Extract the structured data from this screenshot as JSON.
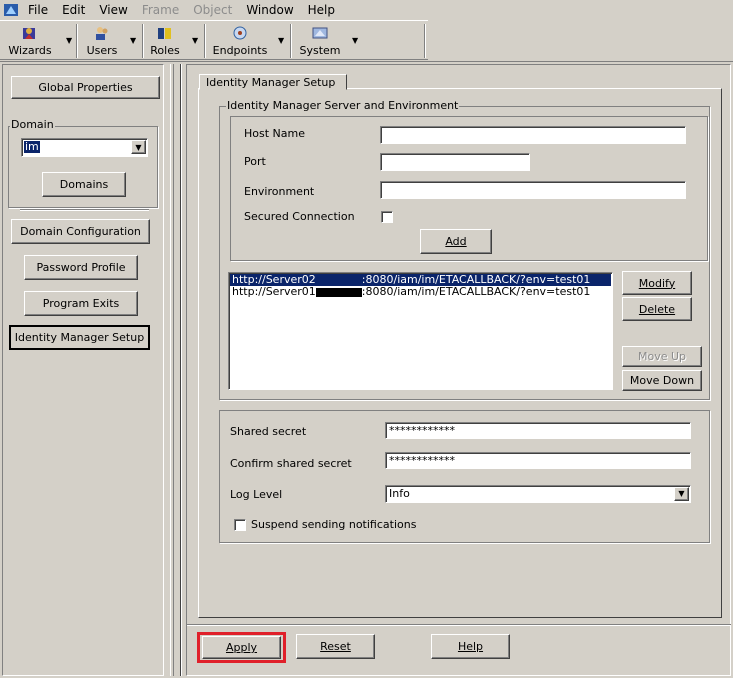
{
  "menubar": {
    "items": [
      {
        "label": "File",
        "enabled": true
      },
      {
        "label": "Edit",
        "enabled": true
      },
      {
        "label": "View",
        "enabled": true
      },
      {
        "label": "Frame",
        "enabled": false
      },
      {
        "label": "Object",
        "enabled": false
      },
      {
        "label": "Window",
        "enabled": true
      },
      {
        "label": "Help",
        "enabled": true
      }
    ]
  },
  "toolbar": {
    "wizards": "Wizards",
    "users": "Users",
    "roles": "Roles",
    "endpoints": "Endpoints",
    "system": "System"
  },
  "sidebar": {
    "global_properties": "Global Properties",
    "domain_group": "Domain",
    "domain_value": "im",
    "domains_button": "Domains",
    "domain_configuration": "Domain Configuration",
    "password_profile": "Password Profile",
    "program_exits": "Program Exits",
    "identity_manager_setup": "Identity Manager Setup"
  },
  "main": {
    "tab": "Identity Manager Setup",
    "group_title": "Identity Manager Server and Environment",
    "host_name_label": "Host Name",
    "host_name_value": "",
    "port_label": "Port",
    "port_value": "",
    "environment_label": "Environment",
    "environment_value": "",
    "secured_connection_label": "Secured Connection",
    "add_button": "Add",
    "servers": [
      {
        "prefix": "http://Server02",
        "suffix": ":8080/iam/im/ETACALLBACK/?env=test01",
        "selected": true
      },
      {
        "prefix": "http://Server01",
        "suffix": ":8080/iam/im/ETACALLBACK/?env=test01",
        "selected": false
      }
    ],
    "modify_button": "Modify",
    "delete_button": "Delete",
    "move_up_button": "Move Up",
    "move_down_button": "Move Down",
    "shared_secret_label": "Shared secret",
    "shared_secret_value": "************",
    "confirm_secret_label": "Confirm shared secret",
    "confirm_secret_value": "************",
    "log_level_label": "Log Level",
    "log_level_value": "Info",
    "suspend_label": "Suspend sending notifications"
  },
  "footer": {
    "apply": "Apply",
    "reset": "Reset",
    "help": "Help"
  },
  "colors": {
    "selection": "#0a246a",
    "highlight_box": "#e0202a"
  }
}
